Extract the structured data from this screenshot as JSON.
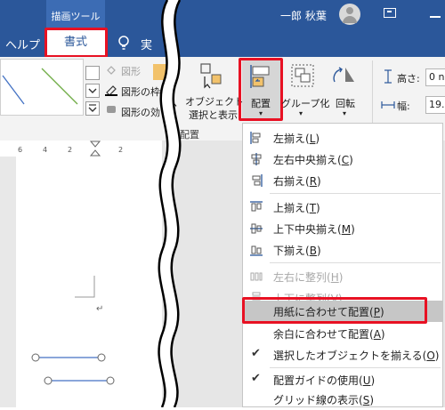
{
  "header": {
    "context_tab_title": "描画ツール",
    "user_name": "一郎 秋葉"
  },
  "tabs": {
    "help": "ヘルプ",
    "format": "書式",
    "tell_me_partial": "実"
  },
  "ribbon": {
    "shape_fill_partial": "図形",
    "shape_outline_partial": "図形の枠",
    "shape_effects_partial": "図形の効",
    "bring_forward_partial": "ヘ",
    "selection_pane_line1": "オブジェクトの",
    "selection_pane_line2": "選択と表示",
    "align_label": "配置",
    "group_label": "グループ化",
    "rotate_label": "回転",
    "height_label": "高さ:",
    "height_value": "0 n",
    "width_label": "幅:",
    "width_value": "19.",
    "arrange_group_label": "配置",
    "size_group_partial": "イズ"
  },
  "ruler": {
    "numbers": [
      "6",
      "4",
      "2",
      "2"
    ]
  },
  "menu": {
    "items": [
      {
        "label": "左揃え",
        "key": "L"
      },
      {
        "label": "左右中央揃え",
        "key": "C"
      },
      {
        "label": "右揃え",
        "key": "R"
      },
      {
        "label": "上揃え",
        "key": "T"
      },
      {
        "label": "上下中央揃え",
        "key": "M"
      },
      {
        "label": "下揃え",
        "key": "B"
      },
      {
        "label": "左右に整列",
        "key": "H"
      },
      {
        "label": "上下に整列",
        "key": "V"
      },
      {
        "label": "用紙に合わせて配置",
        "key": "P"
      },
      {
        "label": "余白に合わせて配置",
        "key": "A"
      },
      {
        "label": "選択したオブジェクトを揃える",
        "key": "O"
      },
      {
        "label": "配置ガイドの使用",
        "key": "U"
      },
      {
        "label": "グリッド線の表示",
        "key": "S"
      }
    ]
  },
  "colors": {
    "brand_blue": "#2b579a",
    "highlight_red": "#e81123",
    "menu_highlight": "#c6c6c6"
  }
}
